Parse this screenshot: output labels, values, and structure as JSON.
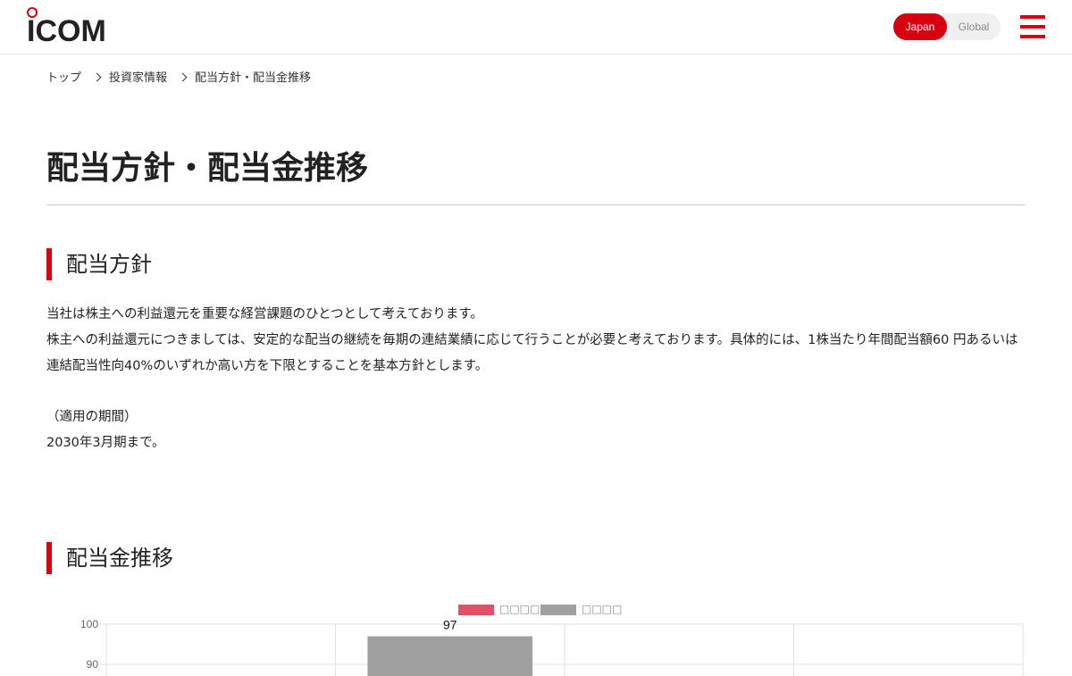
{
  "header": {
    "logo_text": "ICOM",
    "lang_japan": "Japan",
    "lang_global": "Global"
  },
  "breadcrumb": {
    "top": "トップ",
    "investor": "投資家情報",
    "current": "配当方針・配当金推移"
  },
  "page_title": "配当方針・配当金推移",
  "policy": {
    "heading": "配当方針",
    "line1": "当社は株主への利益還元を重要な経営課題のひとつとして考えております。",
    "line2": "株主への利益還元につきましては、安定的な配当の継続を毎期の連結業績に応じて行うことが必要と考えております。具体的には、1株当たり年間配当額60 円あるいは連結配当性向40%のいずれか高い方を下限とすることを基本方針とします。",
    "period_label": "（適用の期間）",
    "period_value": "2030年3月期まで。"
  },
  "trend": {
    "heading": "配当金推移"
  },
  "chart_data": {
    "type": "bar",
    "legend": [
      "□□□□",
      "□□□□"
    ],
    "legend_colors": [
      "#e05066",
      "#a0a0a0"
    ],
    "y_ticks": [
      90,
      100
    ],
    "ylim_visible": [
      88,
      100
    ],
    "series": [
      {
        "values": [
          null,
          97,
          null,
          null
        ]
      }
    ],
    "data_labels": [
      "97"
    ],
    "grid": true
  },
  "colors": {
    "accent": "#d7000f",
    "bar_gray": "#a0a0a0",
    "legend_red": "#e05066"
  }
}
